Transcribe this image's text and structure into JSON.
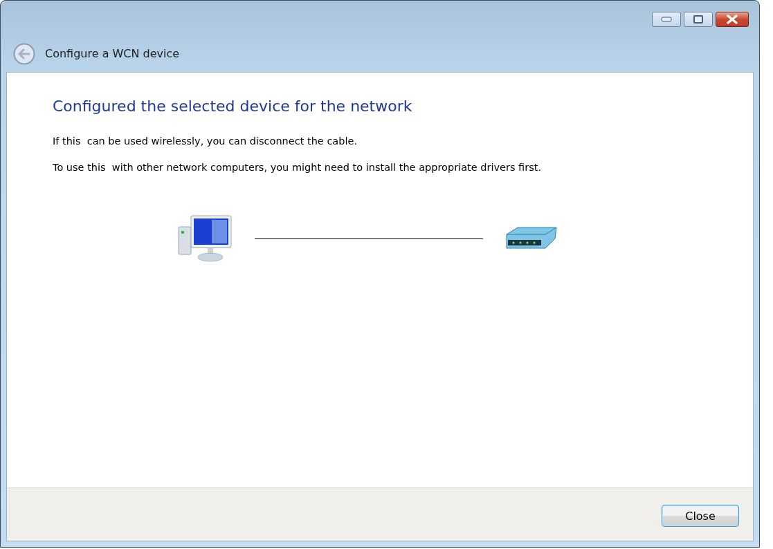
{
  "window": {
    "title": "Configure a WCN device"
  },
  "heading": "Configured the selected device for the network",
  "paragraphs": [
    "If this  can be used wirelessly, you can disconnect the cable.",
    "To use this  with other network computers, you might need to install the appropriate drivers first."
  ],
  "buttons": [
    "Close"
  ]
}
